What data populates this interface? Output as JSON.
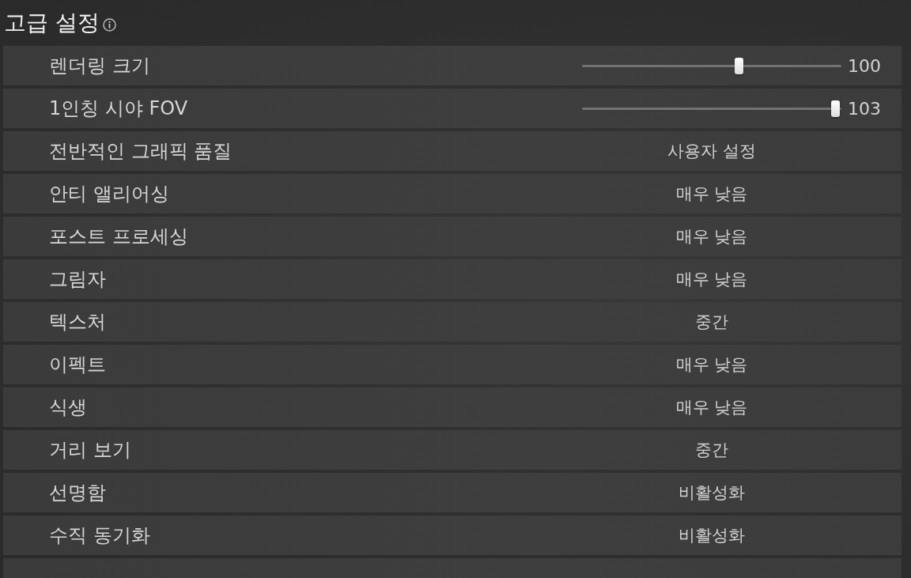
{
  "title": "고급 설정",
  "settings": [
    {
      "kind": "slider",
      "label": "렌더링 크기",
      "level": 0.61,
      "reading": "100"
    },
    {
      "kind": "slider",
      "label": "1인칭 시야 FOV",
      "level": 1,
      "reading": "103"
    },
    {
      "kind": "choice",
      "label": "전반적인 그래픽 품질",
      "value": "사용자 설정"
    },
    {
      "kind": "choice",
      "label": "안티 앨리어싱",
      "value": "매우 낮음"
    },
    {
      "kind": "choice",
      "label": "포스트 프로세싱",
      "value": "매우 낮음"
    },
    {
      "kind": "choice",
      "label": "그림자",
      "value": "매우 낮음"
    },
    {
      "kind": "choice",
      "label": "텍스처",
      "value": "중간"
    },
    {
      "kind": "choice",
      "label": "이펙트",
      "value": "매우 낮음"
    },
    {
      "kind": "choice",
      "label": "식생",
      "value": "매우 낮음"
    },
    {
      "kind": "choice",
      "label": "거리 보기",
      "value": "중간"
    },
    {
      "kind": "choice",
      "label": "선명함",
      "value": "비활성화"
    },
    {
      "kind": "choice",
      "label": "수직 동기화",
      "value": "비활성화"
    },
    {
      "kind": "choice"
    }
  ]
}
